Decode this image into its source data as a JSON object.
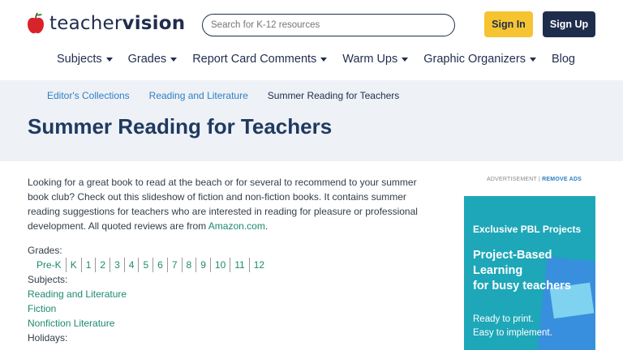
{
  "header": {
    "logo_light": "teacher",
    "logo_bold": "vision",
    "search_placeholder": "Search for K-12 resources",
    "signin_label": "Sign In",
    "signup_label": "Sign Up"
  },
  "nav": {
    "items": [
      {
        "label": "Subjects"
      },
      {
        "label": "Grades"
      },
      {
        "label": "Report Card Comments"
      },
      {
        "label": "Warm Ups"
      },
      {
        "label": "Graphic Organizers"
      },
      {
        "label": "Blog"
      }
    ]
  },
  "breadcrumb": {
    "items": [
      "Editor's Collections",
      "Reading and Literature"
    ],
    "current": "Summer Reading for Teachers"
  },
  "page": {
    "title": "Summer Reading for Teachers",
    "intro_text": "Looking for a great book to read at the beach or for several to recommend to your summer book club? Check out this slideshow of fiction and non-fiction books. It contains summer reading suggestions for teachers who are interested in reading for pleasure or professional development. All quoted reviews are from ",
    "intro_link": "Amazon.com",
    "intro_end": ".",
    "grades_label": "Grades:",
    "grades": [
      "Pre-K",
      "K",
      "1",
      "2",
      "3",
      "4",
      "5",
      "6",
      "7",
      "8",
      "9",
      "10",
      "11",
      "12"
    ],
    "subjects_label": "Subjects:",
    "subjects": [
      "Reading and Literature",
      "Fiction",
      "Nonfiction Literature"
    ],
    "holidays_label": "Holidays:"
  },
  "ad": {
    "label": "ADVERTISEMENT",
    "remove": "REMOVE ADS",
    "headline": "Exclusive PBL Projects",
    "big_line1": "Project-Based",
    "big_line2": "Learning",
    "big_line3": "for busy teachers",
    "small_line1": "Ready to print.",
    "small_line2": "Easy to implement."
  },
  "colors": {
    "brand_navy": "#1f2d4d",
    "signin_yellow": "#f7c431",
    "link_green": "#1d8a6f",
    "breadcrumb_blue": "#2e7fc4",
    "band_bg": "#eef1f6",
    "ad_teal": "#1ea7b8"
  }
}
